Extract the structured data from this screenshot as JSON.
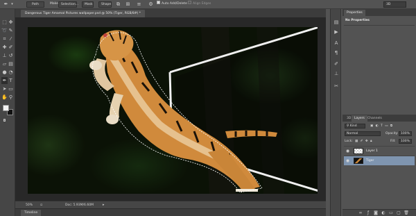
{
  "options_bar": {
    "mode_label": "Path",
    "make_label": "Make:",
    "selection_button": "Selection...",
    "mask_button": "Mask",
    "shape_button": "Shape",
    "auto_add_delete": "Auto Add/Delete",
    "auto_add_delete_checked": true,
    "align_edges": "Align Edges",
    "align_edges_checked": false,
    "workspace": "3D"
  },
  "document": {
    "tab_title": "Dangerous Tiger Amamal Pictures wallpaper.psd @ 50% (Tiger, RGB/8#) *",
    "zoom": "50%",
    "doc_size": "Doc: 5.93M/6.60M",
    "timeline_label": "Timeline"
  },
  "colors": {
    "foreground": "#f2f2f2",
    "background": "#111111",
    "selection_highlight": "#7f95b0"
  },
  "properties_panel": {
    "tabs": [
      "Properties"
    ],
    "title": "No Properties"
  },
  "layers_panel": {
    "tabs": [
      "3D",
      "Layers",
      "Channels"
    ],
    "filter": "Kind",
    "blend_mode": "Normal",
    "opacity_label": "Opacity:",
    "opacity_value": "100%",
    "lock_label": "Lock:",
    "fill_label": "Fill:",
    "fill_value": "100%",
    "layers": [
      {
        "name": "Layer 1",
        "selected": false,
        "visible": true
      },
      {
        "name": "Tiger",
        "selected": true,
        "visible": true
      }
    ]
  }
}
